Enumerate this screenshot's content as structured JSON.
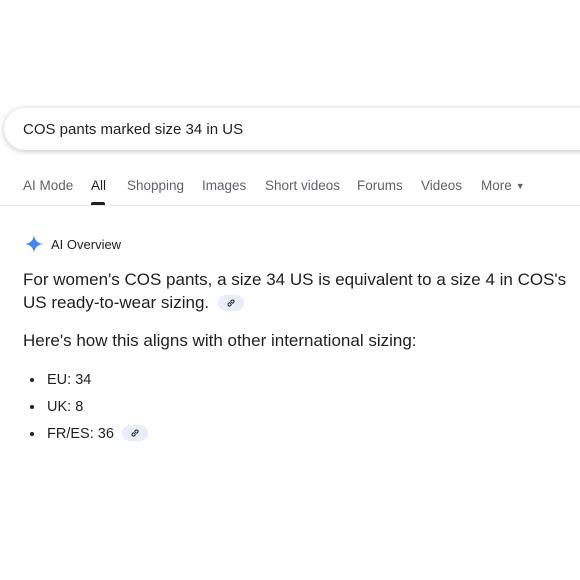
{
  "search": {
    "query": "COS pants marked size 34 in US"
  },
  "tabs": [
    {
      "label": "AI Mode"
    },
    {
      "label": "All"
    },
    {
      "label": "Shopping"
    },
    {
      "label": "Images"
    },
    {
      "label": "Short videos"
    },
    {
      "label": "Forums"
    },
    {
      "label": "Videos"
    },
    {
      "label": "More"
    }
  ],
  "active_tab": "All",
  "ai_overview": {
    "label": "AI Overview",
    "icon": "sparkle-icon",
    "answer": "For women's COS pants, a size 34 US is equivalent to a size 4 in COS's US ready-to-wear sizing.",
    "sub_heading": "Here's how this aligns with other international sizing:",
    "sizes": [
      {
        "text": "EU: 34",
        "has_link": false
      },
      {
        "text": "UK: 8",
        "has_link": false
      },
      {
        "text": "FR/ES: 36",
        "has_link": true
      }
    ]
  },
  "colors": {
    "accent_blue": "#4285f4",
    "link_chip_bg": "#e8eef9",
    "tab_inactive": "#5f6368",
    "text": "#1f1f1f"
  }
}
